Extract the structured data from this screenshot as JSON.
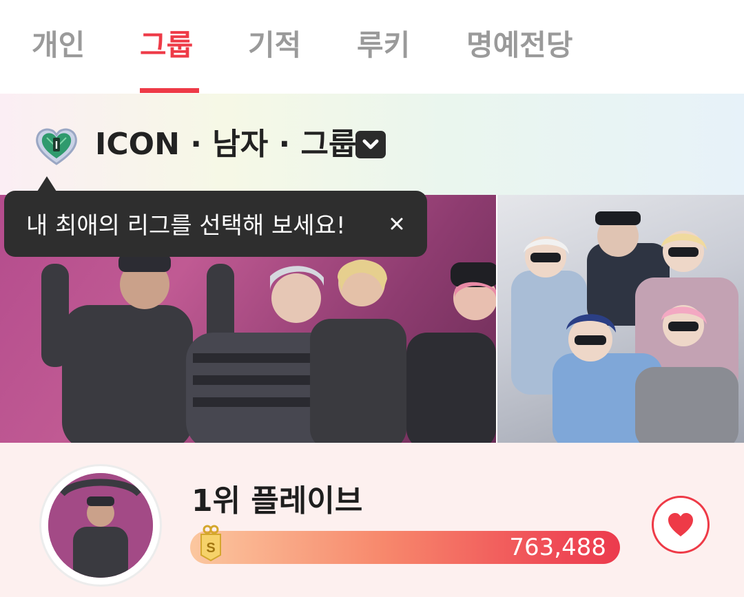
{
  "tabs": [
    {
      "label": "개인",
      "active": false
    },
    {
      "label": "그룹",
      "active": true
    },
    {
      "label": "기적",
      "active": false
    },
    {
      "label": "루키",
      "active": false
    },
    {
      "label": "명예전당",
      "active": false
    }
  ],
  "league": {
    "title": "ICON · 남자 · 그룹",
    "icon": "league-heart-badge-icon",
    "badge_letter": "I"
  },
  "tooltip": {
    "text": "내 최애의 리그를 선택해 보세요!",
    "close_icon": "close-icon"
  },
  "ranking": {
    "first": {
      "title": "1위 플레이브",
      "votes": "763,488",
      "badge_letter": "S",
      "favorite_icon": "heart-icon"
    }
  },
  "colors": {
    "accent": "#ee3a47",
    "tab_inactive": "#9a9a9a",
    "tooltip_bg": "#2e2e2e",
    "rank_bg": "#fdf0ef"
  }
}
